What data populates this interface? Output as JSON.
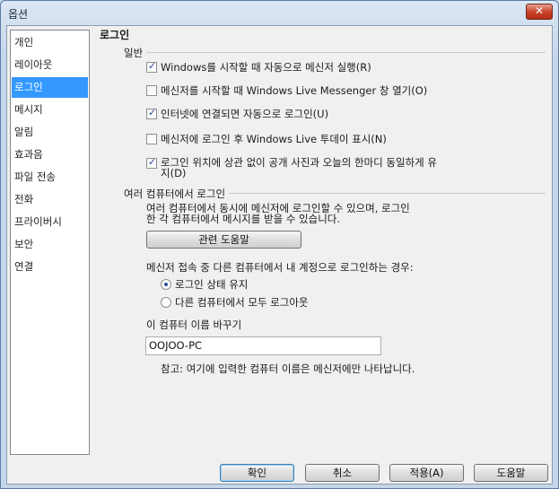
{
  "window": {
    "title": "옵션",
    "close_glyph": "✕"
  },
  "sidebar": {
    "items": [
      {
        "label": "개인"
      },
      {
        "label": "레이아웃"
      },
      {
        "label": "로그인"
      },
      {
        "label": "메시지"
      },
      {
        "label": "알림"
      },
      {
        "label": "효과음"
      },
      {
        "label": "파일 전송"
      },
      {
        "label": "전화"
      },
      {
        "label": "프라이버시"
      },
      {
        "label": "보안"
      },
      {
        "label": "연결"
      }
    ],
    "selected": "로그인"
  },
  "page": {
    "title": "로그인",
    "general": {
      "label": "일반",
      "options": [
        {
          "label": "Windows를 시작할 때 자동으로 메신저 실행(R)",
          "checked": true
        },
        {
          "label": "메신저를 시작할 때 Windows Live Messenger 창 열기(O)",
          "checked": false
        },
        {
          "label": "인터넷에 연결되면 자동으로 로그인(U)",
          "checked": true
        },
        {
          "label": "메신저에 로그인 후 Windows Live 투데이 표시(N)",
          "checked": false
        },
        {
          "label_line1": "로그인 위치에 상관 없이 공개 사진과 오늘의 한마디 동일하게 유",
          "label_line2": "지(D)",
          "checked": true
        }
      ]
    },
    "multi": {
      "label": "여러 컴퓨터에서 로그인",
      "desc_line1": "여러 컴퓨터에서 동시에 메신저에 로그인할 수 있으며, 로그인",
      "desc_line2": "한 각 컴퓨터에서 메시지를 받을 수 있습니다.",
      "help_button": "관련 도움말",
      "question": "메신저 접속 중 다른 컴퓨터에서 내 계정으로 로그인하는 경우:",
      "radios": [
        {
          "label": "로그인 상태 유지",
          "checked": true
        },
        {
          "label": "다른 컴퓨터에서 모두 로그아웃",
          "checked": false
        }
      ],
      "rename_label": "이 컴퓨터 이름 바꾸기",
      "computer_name": "OOJOO-PC",
      "note": "참고: 여기에 입력한 컴퓨터 이름은 메신저에만 나타납니다."
    }
  },
  "footer": {
    "ok": "확인",
    "cancel": "취소",
    "apply": "적용(A)",
    "help": "도움말"
  }
}
